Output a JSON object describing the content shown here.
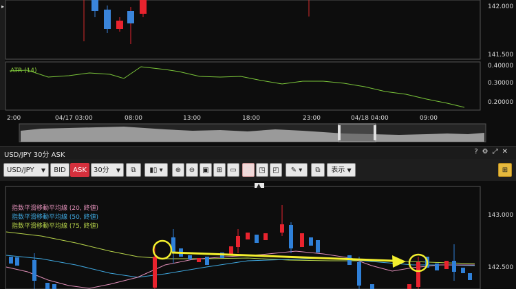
{
  "top_chart": {
    "price_labels": [
      "142.000",
      "141.500"
    ],
    "atr_label": "ATR (14)",
    "atr_labels": [
      "0.40000",
      "0.30000",
      "0.20000"
    ],
    "time_labels": [
      "2:00",
      "04/17 03:00",
      "08:00",
      "13:00",
      "18:00",
      "23:00",
      "04/18 04:00",
      "09:00"
    ]
  },
  "panel": {
    "title": "USD/JPY 30分 ASK",
    "header_icons": [
      "?",
      "⚙",
      "⤢",
      "✕"
    ]
  },
  "toolbar": {
    "symbol": "USD/JPY",
    "bid_label": "BID",
    "ask_label": "ASK",
    "timeframe": "30分",
    "display_label": "表示"
  },
  "bottom_chart": {
    "price_labels": [
      "143.000",
      "142.500"
    ],
    "legend": [
      {
        "text": "指数平滑移動平均線 (20, 終値)",
        "color": "#e08fb8"
      },
      {
        "text": "指数平滑移動平均線 (50, 終値)",
        "color": "#3fa8e0"
      },
      {
        "text": "指数平滑移動平均線 (75, 終値)",
        "color": "#b7d44a"
      }
    ]
  },
  "colors": {
    "up": "#e8232e",
    "down": "#2f80d8",
    "annotation": "#f3ef2e"
  }
}
